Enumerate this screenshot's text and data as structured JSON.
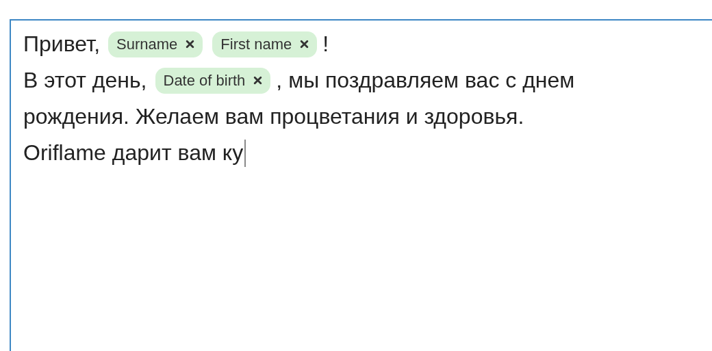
{
  "editor": {
    "lines": [
      [
        {
          "kind": "text",
          "text": "Привет,"
        },
        {
          "kind": "chip",
          "label": "Surname"
        },
        {
          "kind": "chip",
          "label": "First name"
        },
        {
          "kind": "text",
          "text": "!"
        }
      ],
      [
        {
          "kind": "text",
          "text": "В этот день,"
        },
        {
          "kind": "chip",
          "label": "Date of birth"
        },
        {
          "kind": "text",
          "text": ", мы поздравляем вас с днем"
        }
      ],
      [
        {
          "kind": "text",
          "text": "рождения. Желаем вам процветания и здоровья."
        }
      ],
      [
        {
          "kind": "text",
          "text": "Oriflame дарит вам ку"
        },
        {
          "kind": "caret"
        }
      ]
    ]
  }
}
